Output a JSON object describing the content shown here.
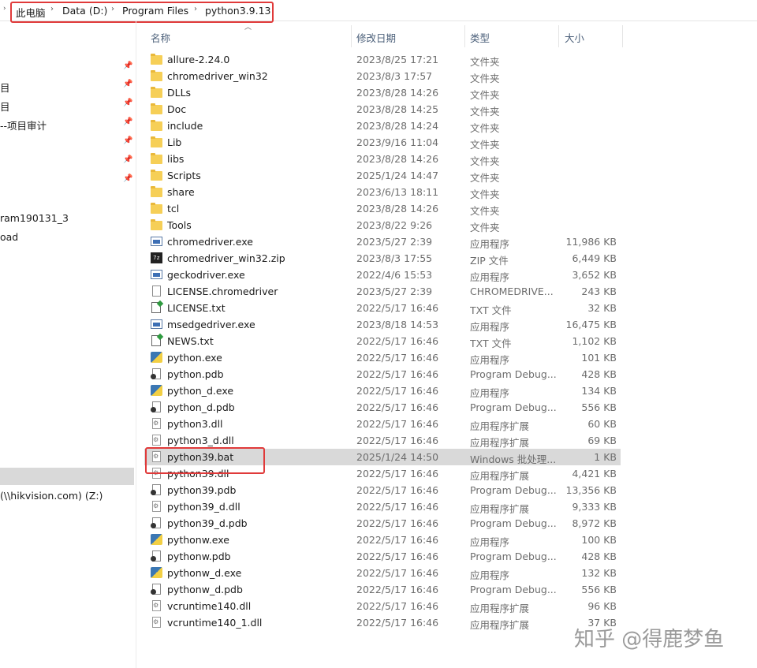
{
  "breadcrumb": {
    "items": [
      "此电脑",
      "Data (D:)",
      "Program Files",
      "python3.9.13"
    ],
    "separator": "›"
  },
  "nav_items": [
    {
      "label": "目",
      "pinned": true
    },
    {
      "label": "目",
      "pinned": true
    },
    {
      "label": "--项目审计",
      "pinned": true
    },
    {
      "label": "",
      "pinned": true
    },
    {
      "label": "",
      "pinned": true
    },
    {
      "label": "",
      "pinned": true
    },
    {
      "label": "ram190131_3",
      "pinned": false
    },
    {
      "label": "oad",
      "pinned": false
    },
    {
      "label": "(\\\\hikvision.com) (Z:)",
      "pinned": false
    }
  ],
  "columns": {
    "name": "名称",
    "date": "修改日期",
    "type": "类型",
    "size": "大小"
  },
  "files": [
    {
      "name": "allure-2.24.0",
      "date": "2023/8/25 17:21",
      "type": "文件夹",
      "size": "",
      "icon": "folder"
    },
    {
      "name": "chromedriver_win32",
      "date": "2023/8/3 17:57",
      "type": "文件夹",
      "size": "",
      "icon": "folder"
    },
    {
      "name": "DLLs",
      "date": "2023/8/28 14:26",
      "type": "文件夹",
      "size": "",
      "icon": "folder"
    },
    {
      "name": "Doc",
      "date": "2023/8/28 14:25",
      "type": "文件夹",
      "size": "",
      "icon": "folder"
    },
    {
      "name": "include",
      "date": "2023/8/28 14:24",
      "type": "文件夹",
      "size": "",
      "icon": "folder"
    },
    {
      "name": "Lib",
      "date": "2023/9/16 11:04",
      "type": "文件夹",
      "size": "",
      "icon": "folder"
    },
    {
      "name": "libs",
      "date": "2023/8/28 14:26",
      "type": "文件夹",
      "size": "",
      "icon": "folder"
    },
    {
      "name": "Scripts",
      "date": "2025/1/24 14:47",
      "type": "文件夹",
      "size": "",
      "icon": "folder"
    },
    {
      "name": "share",
      "date": "2023/6/13 18:11",
      "type": "文件夹",
      "size": "",
      "icon": "folder"
    },
    {
      "name": "tcl",
      "date": "2023/8/28 14:26",
      "type": "文件夹",
      "size": "",
      "icon": "folder"
    },
    {
      "name": "Tools",
      "date": "2023/8/22 9:26",
      "type": "文件夹",
      "size": "",
      "icon": "folder"
    },
    {
      "name": "chromedriver.exe",
      "date": "2023/5/27 2:39",
      "type": "应用程序",
      "size": "11,986 KB",
      "icon": "exe"
    },
    {
      "name": "chromedriver_win32.zip",
      "date": "2023/8/3 17:55",
      "type": "ZIP 文件",
      "size": "6,449 KB",
      "icon": "zip"
    },
    {
      "name": "geckodriver.exe",
      "date": "2022/4/6 15:53",
      "type": "应用程序",
      "size": "3,652 KB",
      "icon": "exe"
    },
    {
      "name": "LICENSE.chromedriver",
      "date": "2023/5/27 2:39",
      "type": "CHROMEDRIVE...",
      "size": "243 KB",
      "icon": "file"
    },
    {
      "name": "LICENSE.txt",
      "date": "2022/5/17 16:46",
      "type": "TXT 文件",
      "size": "32 KB",
      "icon": "txt"
    },
    {
      "name": "msedgedriver.exe",
      "date": "2023/8/18 14:53",
      "type": "应用程序",
      "size": "16,475 KB",
      "icon": "exe"
    },
    {
      "name": "NEWS.txt",
      "date": "2022/5/17 16:46",
      "type": "TXT 文件",
      "size": "1,102 KB",
      "icon": "txt"
    },
    {
      "name": "python.exe",
      "date": "2022/5/17 16:46",
      "type": "应用程序",
      "size": "101 KB",
      "icon": "py"
    },
    {
      "name": "python.pdb",
      "date": "2022/5/17 16:46",
      "type": "Program Debug...",
      "size": "428 KB",
      "icon": "pdb"
    },
    {
      "name": "python_d.exe",
      "date": "2022/5/17 16:46",
      "type": "应用程序",
      "size": "134 KB",
      "icon": "py"
    },
    {
      "name": "python_d.pdb",
      "date": "2022/5/17 16:46",
      "type": "Program Debug...",
      "size": "556 KB",
      "icon": "pdb"
    },
    {
      "name": "python3.dll",
      "date": "2022/5/17 16:46",
      "type": "应用程序扩展",
      "size": "60 KB",
      "icon": "dll"
    },
    {
      "name": "python3_d.dll",
      "date": "2022/5/17 16:46",
      "type": "应用程序扩展",
      "size": "69 KB",
      "icon": "dll"
    },
    {
      "name": "python39.bat",
      "date": "2025/1/24 14:50",
      "type": "Windows 批处理...",
      "size": "1 KB",
      "icon": "bat",
      "selected": true
    },
    {
      "name": "python39.dll",
      "date": "2022/5/17 16:46",
      "type": "应用程序扩展",
      "size": "4,421 KB",
      "icon": "dll"
    },
    {
      "name": "python39.pdb",
      "date": "2022/5/17 16:46",
      "type": "Program Debug...",
      "size": "13,356 KB",
      "icon": "pdb"
    },
    {
      "name": "python39_d.dll",
      "date": "2022/5/17 16:46",
      "type": "应用程序扩展",
      "size": "9,333 KB",
      "icon": "dll"
    },
    {
      "name": "python39_d.pdb",
      "date": "2022/5/17 16:46",
      "type": "Program Debug...",
      "size": "8,972 KB",
      "icon": "pdb"
    },
    {
      "name": "pythonw.exe",
      "date": "2022/5/17 16:46",
      "type": "应用程序",
      "size": "100 KB",
      "icon": "py"
    },
    {
      "name": "pythonw.pdb",
      "date": "2022/5/17 16:46",
      "type": "Program Debug...",
      "size": "428 KB",
      "icon": "pdb"
    },
    {
      "name": "pythonw_d.exe",
      "date": "2022/5/17 16:46",
      "type": "应用程序",
      "size": "132 KB",
      "icon": "py"
    },
    {
      "name": "pythonw_d.pdb",
      "date": "2022/5/17 16:46",
      "type": "Program Debug...",
      "size": "556 KB",
      "icon": "pdb"
    },
    {
      "name": "vcruntime140.dll",
      "date": "2022/5/17 16:46",
      "type": "应用程序扩展",
      "size": "96 KB",
      "icon": "dll"
    },
    {
      "name": "vcruntime140_1.dll",
      "date": "2022/5/17 16:46",
      "type": "应用程序扩展",
      "size": "37 KB",
      "icon": "dll"
    }
  ],
  "watermark": "知乎 @得鹿梦鱼",
  "colors": {
    "highlight_red": "#e03a3a",
    "selected_row": "#d9d9d9",
    "folder_yellow": "#f6cf57"
  }
}
